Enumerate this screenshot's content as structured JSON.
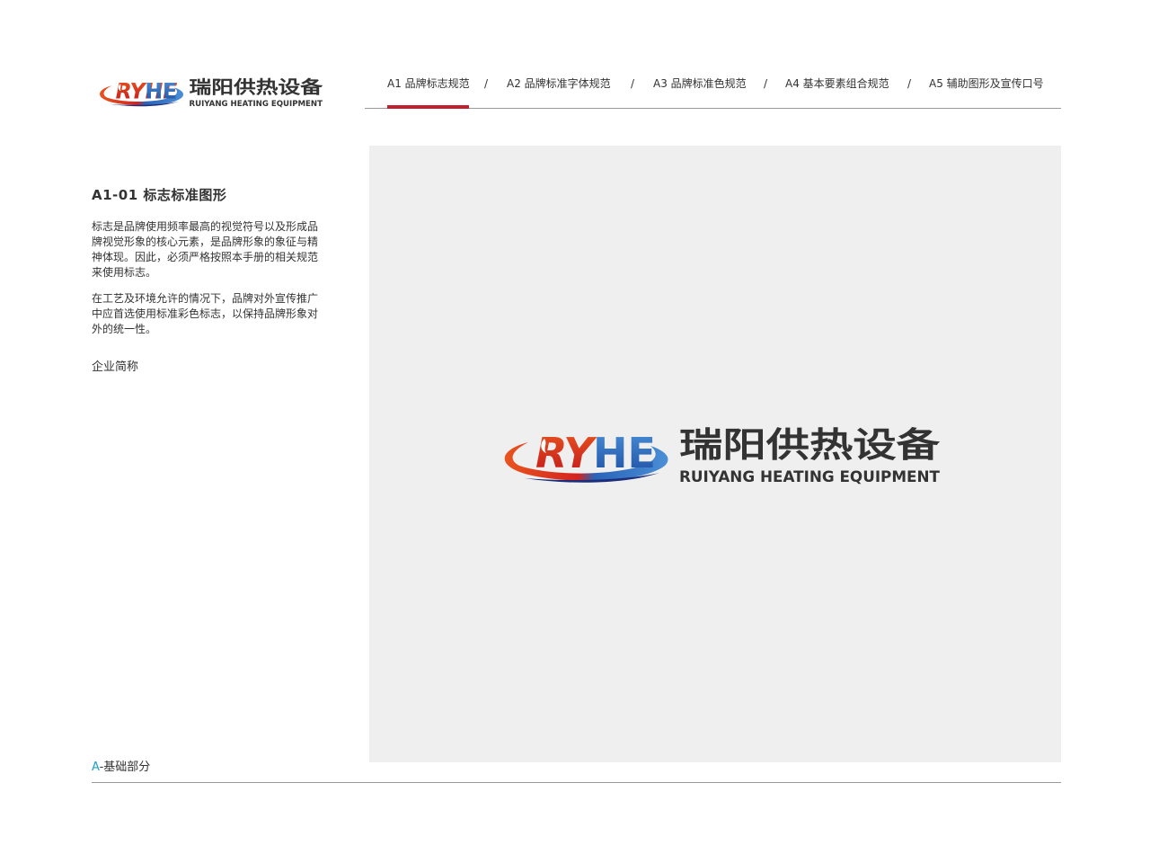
{
  "brand": {
    "mark": "RYHE",
    "name_cn": "瑞阳供热设备",
    "name_en": "RUIYANG HEATING EQUIPMENT",
    "colors": {
      "red": "#d4241f",
      "orange": "#e8541e",
      "blue": "#2a63b8",
      "navy": "#1c2d7a",
      "text": "#333333"
    }
  },
  "nav": {
    "items": [
      {
        "label": "A1 品牌标志规范",
        "active": true
      },
      {
        "label": "A2 品牌标准字体规范",
        "active": false
      },
      {
        "label": "A3 品牌标准色规范",
        "active": false
      },
      {
        "label": "A4 基本要素组合规范",
        "active": false
      },
      {
        "label": "A5 辅助图形及宣传口号",
        "active": false
      }
    ],
    "separator": "/",
    "active_color": "#c3202f"
  },
  "section": {
    "title": "A1-01  标志标准图形",
    "paragraphs": [
      "标志是品牌使用频率最高的视觉符号以及形成品牌视觉形象的核心元素，是品牌形象的象征与精神体现。因此，必须严格按照本手册的相关规范来使用标志。",
      "在工艺及环境允许的情况下，品牌对外宣传推广中应首选使用标准彩色标志，以保持品牌形象对外的统一性。"
    ],
    "sub_label": "企业简称"
  },
  "footer": {
    "accent": "A",
    "label": "-基础部分",
    "accent_color": "#1aa0c8"
  }
}
